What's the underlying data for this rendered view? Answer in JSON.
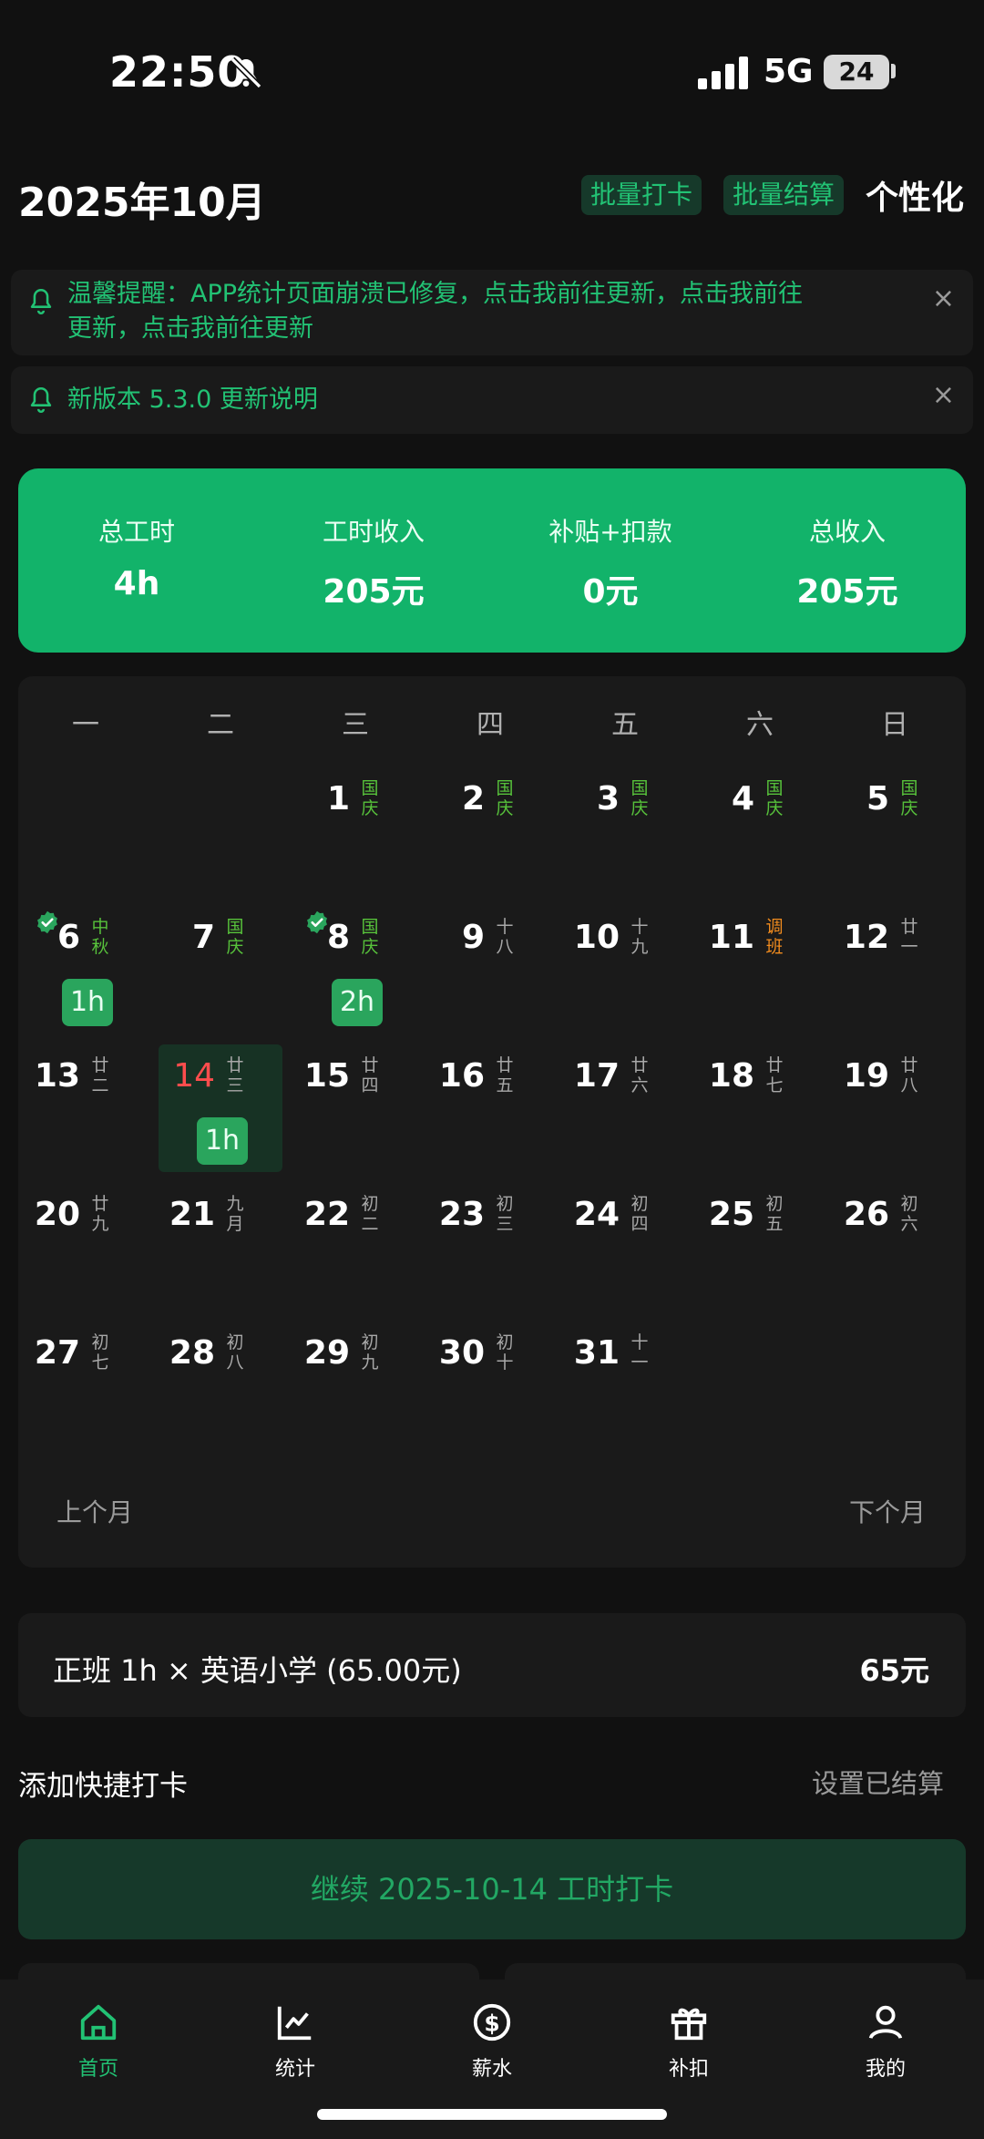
{
  "status": {
    "time": "22:50",
    "network": "5G",
    "battery": "24"
  },
  "header": {
    "title": "2025年10月",
    "batch_checkin": "批量打卡",
    "batch_settle": "批量结算",
    "personalize": "个性化"
  },
  "notices": [
    {
      "text_line1": "温馨提醒：APP统计页面崩溃已修复，点击我前往更新，点击我前往",
      "text_line2": "更新，点击我前往更新",
      "close": "×"
    },
    {
      "text": "新版本 5.3.0 更新说明",
      "close": "×"
    }
  ],
  "summary": [
    {
      "label": "总工时",
      "value": "4h"
    },
    {
      "label": "工时收入",
      "value": "205元"
    },
    {
      "label": "补贴+扣款",
      "value": "0元"
    },
    {
      "label": "总收入",
      "value": "205元"
    }
  ],
  "calendar": {
    "weekdays": [
      "一",
      "二",
      "三",
      "四",
      "五",
      "六",
      "日"
    ],
    "days": [
      {
        "n": "1",
        "l1": "国",
        "l2": "庆",
        "type": "holiday"
      },
      {
        "n": "2",
        "l1": "国",
        "l2": "庆",
        "type": "holiday"
      },
      {
        "n": "3",
        "l1": "国",
        "l2": "庆",
        "type": "holiday"
      },
      {
        "n": "4",
        "l1": "国",
        "l2": "庆",
        "type": "holiday"
      },
      {
        "n": "5",
        "l1": "国",
        "l2": "庆",
        "type": "holiday"
      },
      {
        "n": "6",
        "l1": "中",
        "l2": "秋",
        "type": "holiday",
        "checked": true,
        "hours": "1h"
      },
      {
        "n": "7",
        "l1": "国",
        "l2": "庆",
        "type": "holiday"
      },
      {
        "n": "8",
        "l1": "国",
        "l2": "庆",
        "type": "holiday",
        "checked": true,
        "hours": "2h"
      },
      {
        "n": "9",
        "l1": "十",
        "l2": "八",
        "type": "lunar"
      },
      {
        "n": "10",
        "l1": "十",
        "l2": "九",
        "type": "lunar"
      },
      {
        "n": "11",
        "l1": "调",
        "l2": "班",
        "type": "adjust"
      },
      {
        "n": "12",
        "l1": "廿",
        "l2": "一",
        "type": "lunar"
      },
      {
        "n": "13",
        "l1": "廿",
        "l2": "二",
        "type": "lunar"
      },
      {
        "n": "14",
        "l1": "廿",
        "l2": "三",
        "type": "lunar",
        "today": true,
        "hours": "1h"
      },
      {
        "n": "15",
        "l1": "廿",
        "l2": "四",
        "type": "lunar"
      },
      {
        "n": "16",
        "l1": "廿",
        "l2": "五",
        "type": "lunar"
      },
      {
        "n": "17",
        "l1": "廿",
        "l2": "六",
        "type": "lunar"
      },
      {
        "n": "18",
        "l1": "廿",
        "l2": "七",
        "type": "lunar"
      },
      {
        "n": "19",
        "l1": "廿",
        "l2": "八",
        "type": "lunar"
      },
      {
        "n": "20",
        "l1": "廿",
        "l2": "九",
        "type": "lunar"
      },
      {
        "n": "21",
        "l1": "九",
        "l2": "月",
        "type": "lunar"
      },
      {
        "n": "22",
        "l1": "初",
        "l2": "二",
        "type": "lunar"
      },
      {
        "n": "23",
        "l1": "初",
        "l2": "三",
        "type": "lunar"
      },
      {
        "n": "24",
        "l1": "初",
        "l2": "四",
        "type": "lunar"
      },
      {
        "n": "25",
        "l1": "初",
        "l2": "五",
        "type": "lunar"
      },
      {
        "n": "26",
        "l1": "初",
        "l2": "六",
        "type": "lunar"
      },
      {
        "n": "27",
        "l1": "初",
        "l2": "七",
        "type": "lunar"
      },
      {
        "n": "28",
        "l1": "初",
        "l2": "八",
        "type": "lunar"
      },
      {
        "n": "29",
        "l1": "初",
        "l2": "九",
        "type": "lunar"
      },
      {
        "n": "30",
        "l1": "初",
        "l2": "十",
        "type": "lunar"
      },
      {
        "n": "31",
        "l1": "十",
        "l2": "一",
        "type": "lunar"
      }
    ],
    "prev_month": "上个月",
    "next_month": "下个月",
    "colors": {
      "holiday": "#57c23b",
      "adjust": "#f28c1e",
      "today": "#ff4d4d",
      "accent": "#22c274"
    }
  },
  "entry": {
    "text": "正班 1h × 英语小学 (65.00元)",
    "amount": "65元"
  },
  "actions": {
    "quick_checkin": "添加快捷打卡",
    "set_settled": "设置已结算",
    "continue": "继续 2025-10-14 工时打卡"
  },
  "tabs": [
    {
      "label": "首页",
      "icon": "home-icon",
      "active": true
    },
    {
      "label": "统计",
      "icon": "chart-icon"
    },
    {
      "label": "薪水",
      "icon": "dollar-icon"
    },
    {
      "label": "补扣",
      "icon": "gift-icon"
    },
    {
      "label": "我的",
      "icon": "user-icon"
    }
  ]
}
